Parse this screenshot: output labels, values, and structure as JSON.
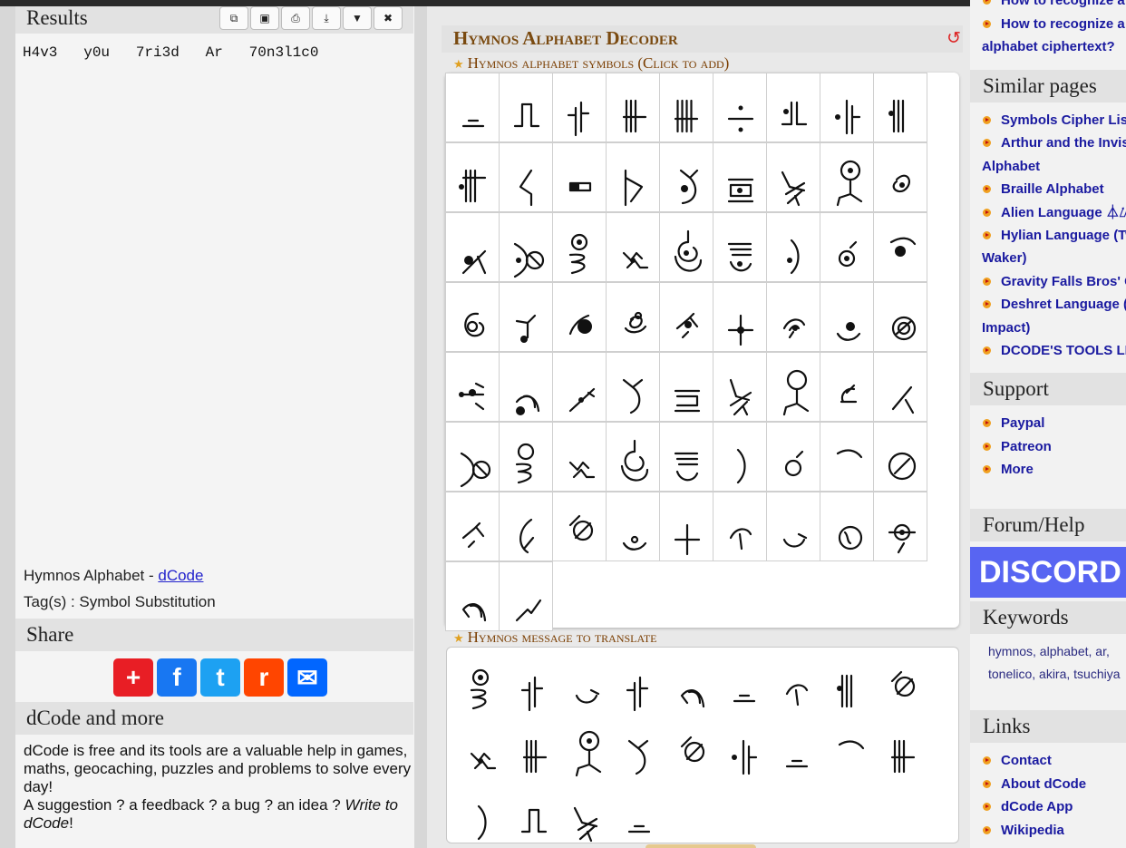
{
  "results": {
    "title": "Results",
    "toolbar": [
      {
        "icon": "copy-icon",
        "glyph": "⧉"
      },
      {
        "icon": "screenshot-icon",
        "glyph": "▣"
      },
      {
        "icon": "print-icon",
        "glyph": "⎙"
      },
      {
        "icon": "download-icon",
        "glyph": "⤓"
      },
      {
        "icon": "pin-icon",
        "glyph": "▼"
      },
      {
        "icon": "close-icon",
        "glyph": "✖"
      }
    ],
    "text": "H4v3   y0u   7ri3d   Ar   70n3l1c0"
  },
  "info": {
    "name_prefix": "Hymnos Alphabet - ",
    "name_link": "dCode",
    "tags": "Tag(s) : Symbol Substitution"
  },
  "share": {
    "title": "Share",
    "buttons": [
      {
        "name": "addtoany",
        "glyph": "+",
        "color": "#e81e25"
      },
      {
        "name": "facebook",
        "glyph": "f",
        "color": "#1877f2"
      },
      {
        "name": "twitter",
        "glyph": "t",
        "color": "#1da1f2"
      },
      {
        "name": "reddit",
        "glyph": "r",
        "color": "#ff4500"
      },
      {
        "name": "email",
        "glyph": "✉",
        "color": "#0166ff"
      }
    ]
  },
  "more": {
    "title": "dCode and more",
    "text1": "dCode is free and its tools are a valuable help in games, maths, geocaching, puzzles and problems to solve every day!",
    "text2": "A suggestion ? a feedback ? a bug ? an idea ? ",
    "write": "Write to dCode",
    "end": "!"
  },
  "tool": {
    "title": "Hymnos Alphabet Decoder",
    "symbols_header": "Hymnos alphabet symbols (Click to add)",
    "message_header": "Hymnos message to translate"
  },
  "sidebar": {
    "top_links": [
      {
        "label": "How to recognize a"
      },
      {
        "label": "alphabet ciphertext?",
        "continuation": true
      }
    ],
    "similar_title": "Similar pages",
    "similar": [
      {
        "label": "Symbols Cipher List"
      },
      {
        "label": "Arthur and the Invisibles"
      },
      {
        "label": "Alphabet",
        "continuation": true
      },
      {
        "label": "Braille Alphabet"
      },
      {
        "label": "Alien Language ⏃⌰⟟⟒⋏"
      },
      {
        "label": "Hylian Language (Twilight"
      },
      {
        "label": "Waker)",
        "continuation": true
      },
      {
        "label": "Gravity Falls Bros' Cipher"
      },
      {
        "label": "Deshret Language (Genshin"
      },
      {
        "label": "Impact)",
        "continuation": true
      },
      {
        "label": "DCODE'S TOOLS LIST"
      }
    ],
    "support_title": "Support",
    "support": [
      {
        "label": "Paypal"
      },
      {
        "label": "Patreon"
      },
      {
        "label": "More"
      }
    ],
    "forum_title": "Forum/Help",
    "discord_label": "DISCORD",
    "keywords_title": "Keywords",
    "keywords_line1": "hymnos, alphabet, ar,",
    "keywords_line2": "tonelico, akira, tsuchiya",
    "links_title": "Links",
    "links": [
      {
        "label": "Contact"
      },
      {
        "label": "About dCode"
      },
      {
        "label": "dCode App"
      },
      {
        "label": "Wikipedia"
      }
    ]
  },
  "alphabet_icons": [
    "dash",
    "bar1",
    "bar2",
    "bar3",
    "bar4",
    "divide",
    "dot-bar1",
    "dot-bar2",
    "dot-bar3",
    "dot-bar4",
    "hook",
    "rect",
    "bend",
    "chi-dot",
    "boxdot",
    "fan",
    "head",
    "swirl",
    "slash-dot",
    "double-circle",
    "ring-coil",
    "pinch",
    "spiral",
    "cup-bars",
    "hook-dot",
    "ring-dot",
    "blob",
    "target",
    "dot-stem",
    "half-blob",
    "coil",
    "stick-dot",
    "cross-dot",
    "eye",
    "dot-cup",
    "ring-target",
    "arrow-dot",
    "blob-cup",
    "slash-circle",
    "chi",
    "box",
    "fan2",
    "head2",
    "claw",
    "vee",
    "double-ring",
    "ring-coil2",
    "pinch2",
    "spiral2",
    "cup-bars2",
    "hook2",
    "loop",
    "tick",
    "ring-slash",
    "stick",
    "curve",
    "ring-slash2",
    "dot-cup2",
    "cross",
    "tee",
    "sig",
    "face",
    "arrow-ring",
    "cup2",
    "zig"
  ],
  "message_icons": [
    "ring-coil",
    "bar2",
    "sig",
    "bar2",
    "cup2",
    "dash",
    "tee",
    "dot-bar3",
    "ring-slash2",
    "pinch",
    "bar3",
    "head",
    "chi",
    "ring-slash2",
    "dot-bar2",
    "dash",
    "tick",
    "bar3",
    "hook2",
    "bar1",
    "fan",
    "dash"
  ]
}
